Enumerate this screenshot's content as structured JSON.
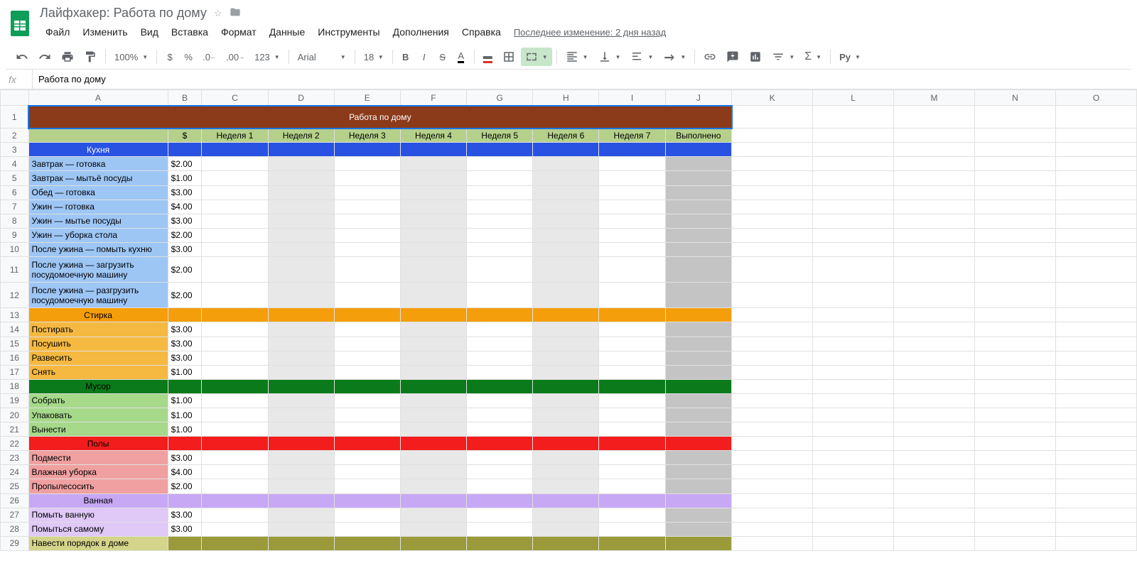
{
  "doc": {
    "title": "Лайфхакер: Работа по дому"
  },
  "menu": {
    "file": "Файл",
    "edit": "Изменить",
    "view": "Вид",
    "insert": "Вставка",
    "format": "Формат",
    "data": "Данные",
    "tools": "Инструменты",
    "addons": "Дополнения",
    "help": "Справка",
    "last_edit": "Последнее изменение: 2 дня назад"
  },
  "toolbar": {
    "zoom": "100%",
    "123": "123",
    "font": "Arial",
    "size": "18",
    "ру": "Ру"
  },
  "formula": {
    "fx": "fx",
    "value": "Работа по дому"
  },
  "columns": [
    "A",
    "B",
    "C",
    "D",
    "E",
    "F",
    "G",
    "H",
    "I",
    "J",
    "K",
    "L",
    "M",
    "N",
    "O"
  ],
  "title_row": "Работа по дому",
  "headers": {
    "dollar": "$",
    "w1": "Неделя 1",
    "w2": "Неделя 2",
    "w3": "Неделя 3",
    "w4": "Неделя 4",
    "w5": "Неделя 5",
    "w6": "Неделя 6",
    "w7": "Неделя 7",
    "done": "Выполнено"
  },
  "sections": {
    "kitchen": "Кухня",
    "laundry": "Стирка",
    "trash": "Мусор",
    "floors": "Полы",
    "bath": "Ванная",
    "other": "Навести порядок в доме"
  },
  "tasks": {
    "kitchen": [
      {
        "name": "Завтрак — готовка",
        "price": "$2.00"
      },
      {
        "name": "Завтрак — мытьё посуды",
        "price": "$1.00"
      },
      {
        "name": "Обед — готовка",
        "price": "$3.00"
      },
      {
        "name": "Ужин — готовка",
        "price": "$4.00"
      },
      {
        "name": "Ужин — мытье посуды",
        "price": "$3.00"
      },
      {
        "name": "Ужин — уборка стола",
        "price": "$2.00"
      },
      {
        "name": "После ужина — помыть кухню",
        "price": "$3.00"
      },
      {
        "name": "После ужина — загрузить посудомоечную машину",
        "price": "$2.00"
      },
      {
        "name": "После ужина — разгрузить посудомоечную машину",
        "price": "$2.00"
      }
    ],
    "laundry": [
      {
        "name": "Постирать",
        "price": "$3.00"
      },
      {
        "name": "Посушить",
        "price": "$3.00"
      },
      {
        "name": "Развесить",
        "price": "$3.00"
      },
      {
        "name": "Снять",
        "price": "$1.00"
      }
    ],
    "trash": [
      {
        "name": "Собрать",
        "price": "$1.00"
      },
      {
        "name": "Упаковать",
        "price": "$1.00"
      },
      {
        "name": "Вынести",
        "price": "$1.00"
      }
    ],
    "floors": [
      {
        "name": "Подмести",
        "price": "$3.00"
      },
      {
        "name": "Влажная уборка",
        "price": "$4.00"
      },
      {
        "name": "Пропылесосить",
        "price": "$2.00"
      }
    ],
    "bath": [
      {
        "name": "Помыть ванную",
        "price": "$3.00"
      },
      {
        "name": "Помыться самому",
        "price": "$3.00"
      }
    ]
  }
}
